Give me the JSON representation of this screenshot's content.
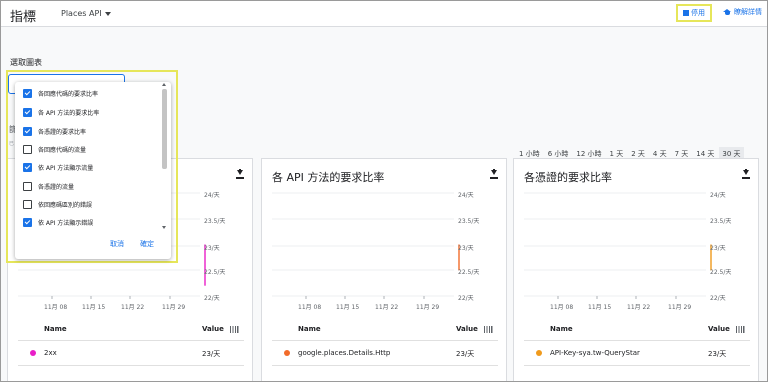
{
  "header": {
    "title": "指標",
    "api_selector": "Places API",
    "disable_button": "停用",
    "learn_more": "瞭解詳情"
  },
  "chart_selector": {
    "label": "選取圖表",
    "options": [
      {
        "label": "各回應代碼的要求比率",
        "checked": true
      },
      {
        "label": "各 API 方法的要求比率",
        "checked": true
      },
      {
        "label": "各憑證的要求比率",
        "checked": true
      },
      {
        "label": "各回應代碼的流量",
        "checked": false
      },
      {
        "label": "依 API 方法顯示流量",
        "checked": true
      },
      {
        "label": "各憑證的流量",
        "checked": false
      },
      {
        "label": "依回應碼區別的錯誤",
        "checked": false
      },
      {
        "label": "依 API 方法顯示錯誤",
        "checked": true
      }
    ],
    "cancel": "取消",
    "confirm": "確定"
  },
  "background_partial_text": {
    "letter": "篩",
    "sub": "已"
  },
  "time_ranges": [
    {
      "label": "1 小時",
      "active": false
    },
    {
      "label": "6 小時",
      "active": false
    },
    {
      "label": "12 小時",
      "active": false
    },
    {
      "label": "1 天",
      "active": false
    },
    {
      "label": "2 天",
      "active": false
    },
    {
      "label": "4 天",
      "active": false
    },
    {
      "label": "7 天",
      "active": false
    },
    {
      "label": "14 天",
      "active": false
    },
    {
      "label": "30 天",
      "active": true
    }
  ],
  "table_headers": {
    "name": "Name",
    "value": "Value"
  },
  "cards": [
    {
      "title": "",
      "row": {
        "name": "2xx",
        "value": "23/天",
        "color": "#e91ec8"
      },
      "chart_data": {
        "type": "line",
        "x_ticks": [
          "11月 08",
          "11月 15",
          "11月 22",
          "11月 29"
        ],
        "y_ticks": [
          "24/天",
          "23.5/天",
          "23/天",
          "22.5/天",
          "22/天"
        ],
        "ylim": [
          22,
          24
        ],
        "series": [
          {
            "name": "2xx",
            "color": "#e91ec8",
            "x": [
              "11月 30",
              "11月 30"
            ],
            "y": [
              23,
              22.2
            ]
          }
        ]
      }
    },
    {
      "title": "各 API 方法的要求比率",
      "row": {
        "name": "google.places.Details.Http",
        "value": "23/天",
        "color": "#f26b2a"
      },
      "chart_data": {
        "type": "line",
        "x_ticks": [
          "11月 08",
          "11月 15",
          "11月 22",
          "11月 29"
        ],
        "y_ticks": [
          "24/天",
          "23.5/天",
          "23/天",
          "22.5/天",
          "22/天"
        ],
        "ylim": [
          22,
          24
        ],
        "series": [
          {
            "name": "google.places.Details.Http",
            "color": "#f26b2a",
            "x": [
              "11月 30",
              "11月 30"
            ],
            "y": [
              23,
              22.5
            ]
          }
        ]
      }
    },
    {
      "title": "各憑證的要求比率",
      "row": {
        "name": "API-Key-sya.tw-QueryStar",
        "value": "23/天",
        "color": "#f09a1c"
      },
      "chart_data": {
        "type": "line",
        "x_ticks": [
          "11月 08",
          "11月 15",
          "11月 22",
          "11月 29"
        ],
        "y_ticks": [
          "24/天",
          "23.5/天",
          "23/天",
          "22.5/天",
          "22/天"
        ],
        "ylim": [
          22,
          24
        ],
        "series": [
          {
            "name": "API-Key-sya.tw-QueryStar",
            "color": "#f09a1c",
            "x": [
              "11月 30",
              "11月 30"
            ],
            "y": [
              23,
              22.5
            ]
          }
        ]
      }
    }
  ]
}
